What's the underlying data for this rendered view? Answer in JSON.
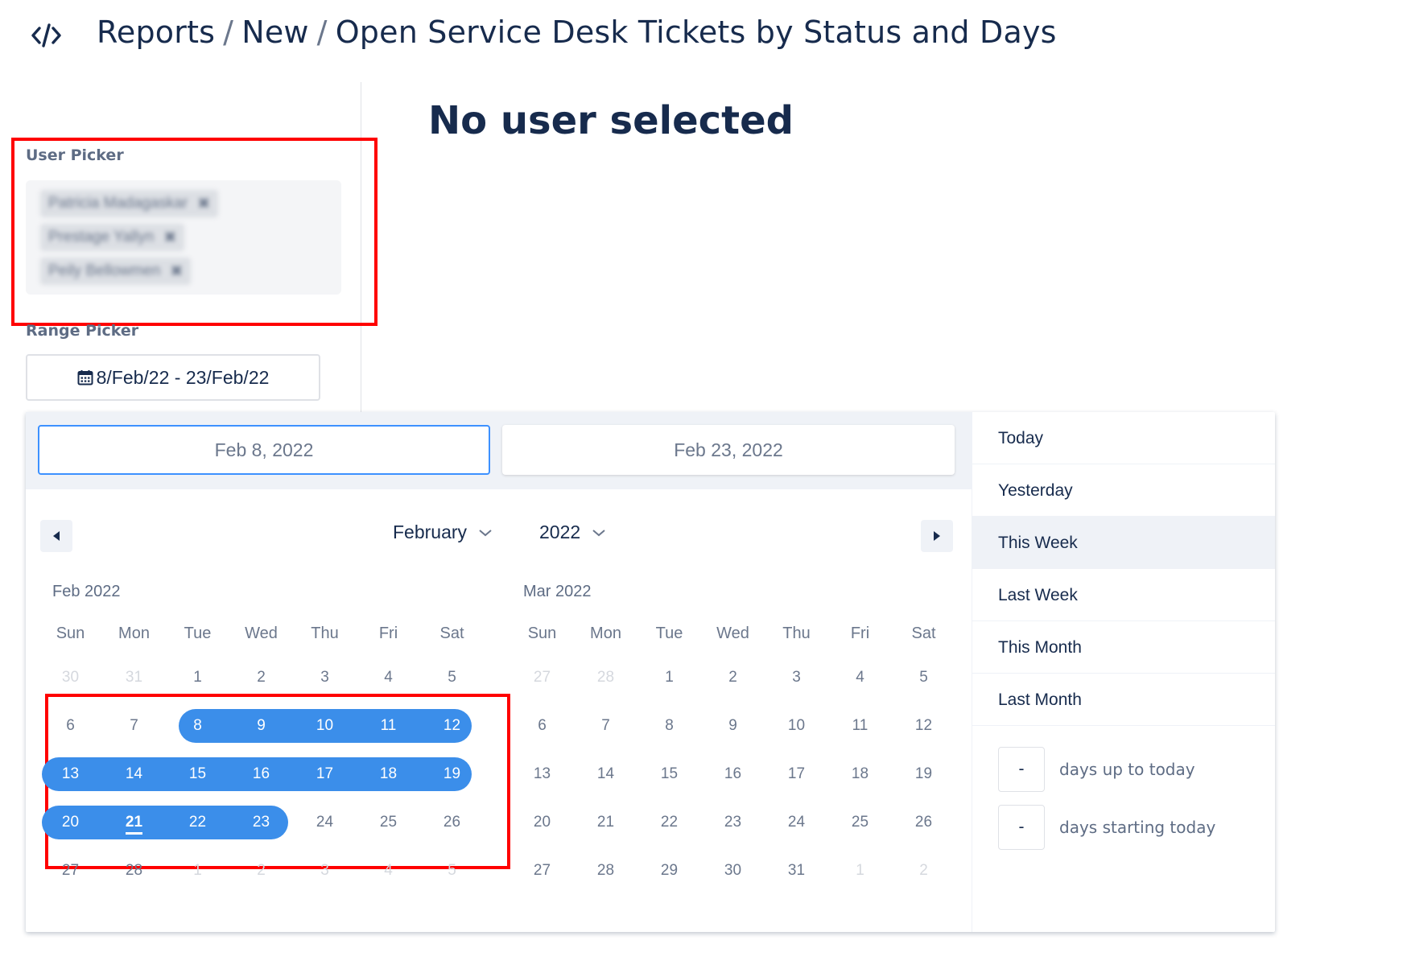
{
  "header": {
    "crumb1": "Reports",
    "crumb2": "New",
    "crumb3": "Open Service Desk Tickets by Status and Days",
    "separator": "/"
  },
  "sidebar": {
    "user_picker_label": "User Picker",
    "users": [
      {
        "name": "Patricia Madagaskar",
        "remove": "✖"
      },
      {
        "name": "Prestage Yallyn",
        "remove": "✖"
      },
      {
        "name": "Peily Bellowmen",
        "remove": "✖"
      }
    ],
    "range_picker_label": "Range Picker",
    "range_value": "8/Feb/22 - 23/Feb/22"
  },
  "main": {
    "title": "No user selected"
  },
  "picker": {
    "start_date": "Feb 8, 2022",
    "end_date": "Feb 23, 2022",
    "month": "February",
    "year": "2022",
    "weekdays": [
      "Sun",
      "Mon",
      "Tue",
      "Wed",
      "Thu",
      "Fri",
      "Sat"
    ],
    "left_title": "Feb 2022",
    "right_title": "Mar 2022",
    "feb_weeks": [
      [
        "30",
        "31",
        "1",
        "2",
        "3",
        "4",
        "5"
      ],
      [
        "6",
        "7",
        "8",
        "9",
        "10",
        "11",
        "12"
      ],
      [
        "13",
        "14",
        "15",
        "16",
        "17",
        "18",
        "19"
      ],
      [
        "20",
        "21",
        "22",
        "23",
        "24",
        "25",
        "26"
      ],
      [
        "27",
        "28",
        "1",
        "2",
        "3",
        "4",
        "5"
      ]
    ],
    "mar_weeks": [
      [
        "27",
        "28",
        "1",
        "2",
        "3",
        "4",
        "5"
      ],
      [
        "6",
        "7",
        "8",
        "9",
        "10",
        "11",
        "12"
      ],
      [
        "13",
        "14",
        "15",
        "16",
        "17",
        "18",
        "19"
      ],
      [
        "20",
        "21",
        "22",
        "23",
        "24",
        "25",
        "26"
      ],
      [
        "27",
        "28",
        "29",
        "30",
        "31",
        "1",
        "2"
      ]
    ],
    "presets": [
      "Today",
      "Yesterday",
      "This Week",
      "Last Week",
      "This Month",
      "Last Month"
    ],
    "highlighted_preset": "This Week",
    "days_up_value": "-",
    "days_up_label": "days up to today",
    "days_start_value": "-",
    "days_start_label": "days starting today",
    "colors": {
      "selection": "#3b8eea",
      "annotation": "#ff0000",
      "text": "#172b4d"
    }
  }
}
